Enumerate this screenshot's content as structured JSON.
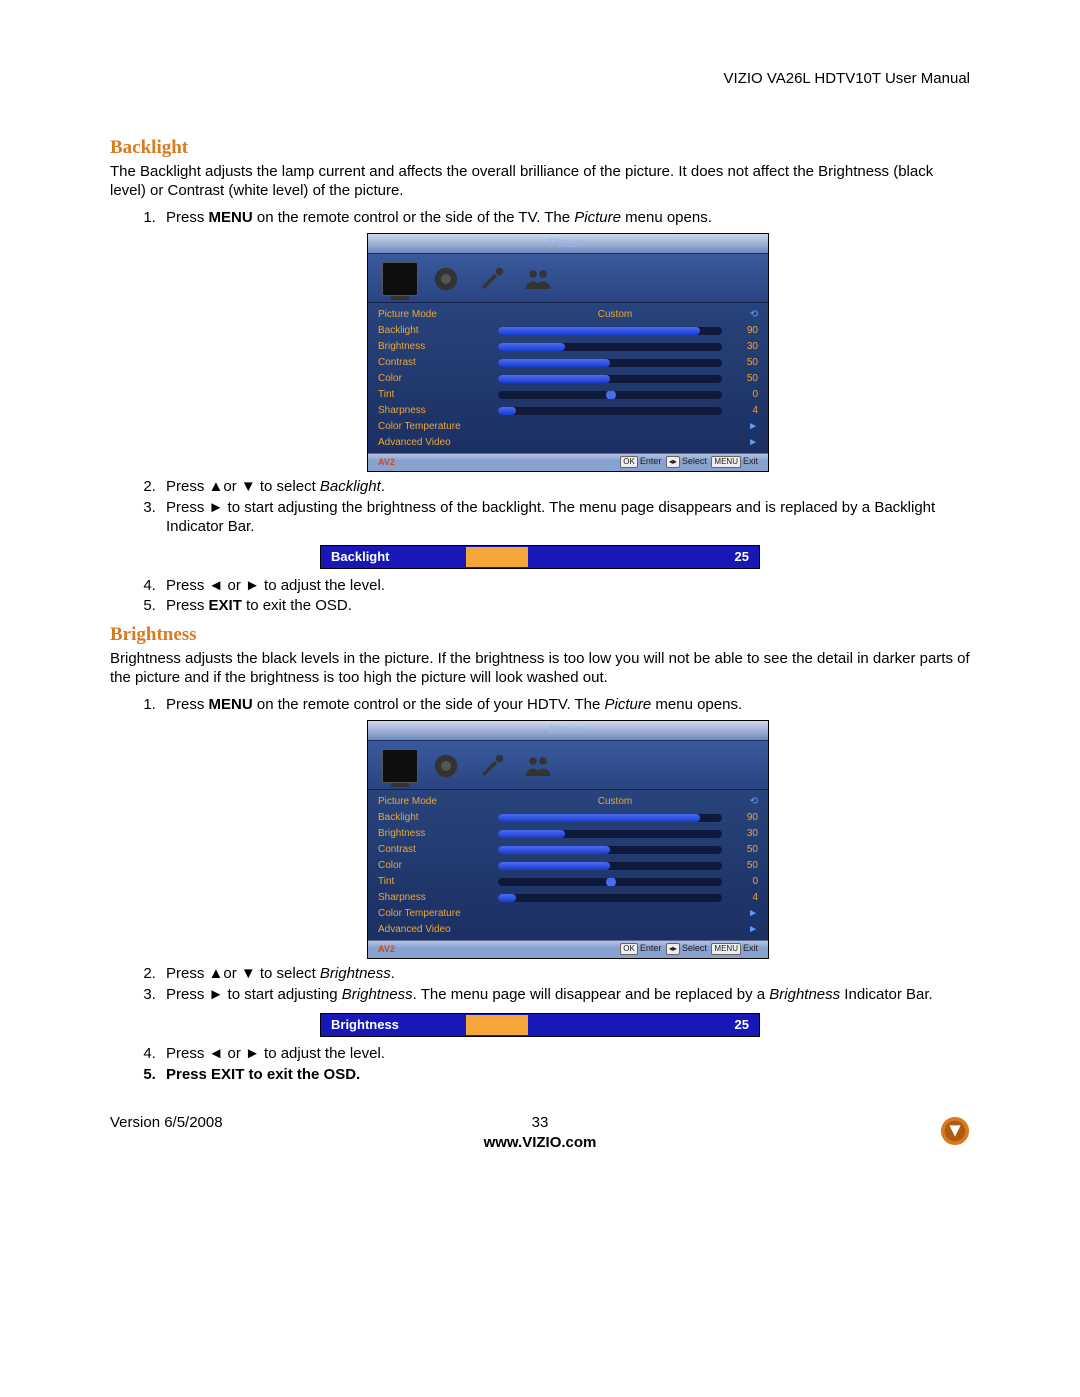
{
  "header": {
    "manual": "VIZIO VA26L HDTV10T User Manual"
  },
  "sections": {
    "backlight": {
      "title": "Backlight",
      "desc": "The Backlight adjusts the lamp current and affects the overall brilliance of the picture. It does not affect the Brightness (black level) or Contrast (white level) of the picture.",
      "s1a": "Press ",
      "s1b": "MENU",
      "s1c": " on the remote control or the side of the TV. The ",
      "s1d": "Picture",
      "s1e": " menu opens.",
      "s2a": "Press ▲or ▼ to select ",
      "s2b": "Backlight",
      "s2c": ".",
      "s3": "Press ► to start adjusting the brightness of the backlight. The menu page disappears and is replaced by a Backlight Indicator Bar.",
      "s4": "Press ◄ or ► to adjust the level.",
      "s5a": "Press ",
      "s5b": "EXIT",
      "s5c": " to exit the OSD."
    },
    "brightness": {
      "title": "Brightness",
      "desc": "Brightness adjusts the black levels in the picture. If the brightness is too low you will not be able to see the detail in darker parts of the picture and if the brightness is too high the picture will look washed out.",
      "s1a": "Press ",
      "s1b": "MENU",
      "s1c": " on the remote control or the side of your HDTV. The ",
      "s1d": "Picture",
      "s1e": " menu opens.",
      "s2a": "Press ▲or ▼ to select ",
      "s2b": "Brightness",
      "s2c": ".",
      "s3a": "Press ► to start adjusting ",
      "s3b": "Brightness",
      "s3c": ". The menu page will disappear and be replaced by a ",
      "s3d": "Brightness",
      "s3e": " Indicator Bar.",
      "s4": "Press ◄ or ► to adjust the level.",
      "s5": "Press EXIT to exit the OSD."
    }
  },
  "osd": {
    "title": "Picture",
    "rows": {
      "picture_mode": {
        "label": "Picture Mode",
        "value": "Custom"
      },
      "backlight": {
        "label": "Backlight",
        "value": "90",
        "pct": 90
      },
      "brightness": {
        "label": "Brightness",
        "value": "30",
        "pct": 30
      },
      "contrast": {
        "label": "Contrast",
        "value": "50",
        "pct": 50
      },
      "color": {
        "label": "Color",
        "value": "50",
        "pct": 50
      },
      "tint": {
        "label": "Tint",
        "value": "0",
        "knob": 50
      },
      "sharpness": {
        "label": "Sharpness",
        "value": "4",
        "pct": 8
      },
      "color_temp": {
        "label": "Color Temperature"
      },
      "adv_video": {
        "label": "Advanced Video"
      }
    },
    "footer": {
      "source": "AV2",
      "hint_ok": "OK",
      "hint_enter": "Enter",
      "hint_select": "Select",
      "hint_menu": "MENU",
      "hint_exit": "Exit"
    }
  },
  "indicators": {
    "backlight": {
      "label": "Backlight",
      "value": "25",
      "pct": 25
    },
    "brightness": {
      "label": "Brightness",
      "value": "25",
      "pct": 25
    }
  },
  "footer": {
    "version": "Version 6/5/2008",
    "page": "33",
    "url": "www.VIZIO.com"
  }
}
